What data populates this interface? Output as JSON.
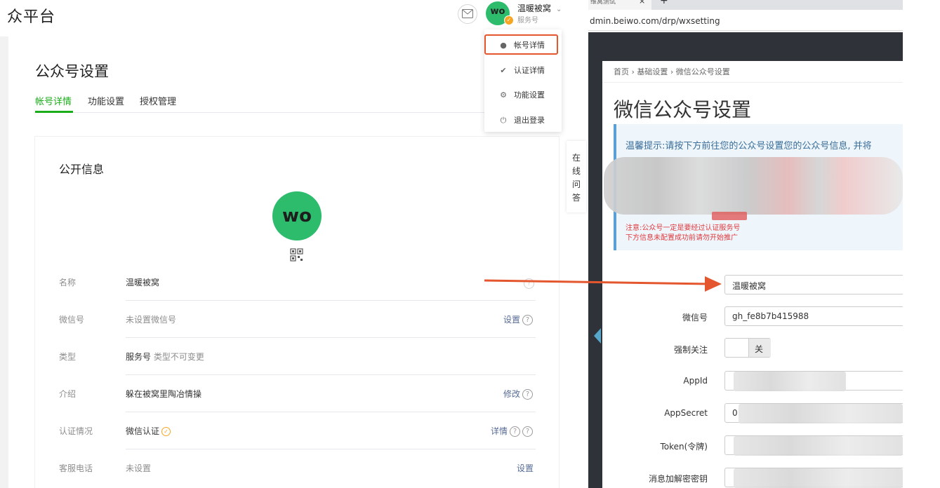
{
  "left": {
    "brand": "众平台",
    "header": {
      "account_name": "温暖被窝",
      "account_type": "服务号",
      "avatar_text": "wo"
    },
    "page_title": "公众号设置",
    "tabs": [
      "帐号详情",
      "功能设置",
      "授权管理"
    ],
    "section_title": "公开信息",
    "qr_icon": "qrcode-icon",
    "rows": [
      {
        "label": "名称",
        "value": "温暖被窝",
        "sub": "",
        "action": ""
      },
      {
        "label": "微信号",
        "value": "未设置微信号",
        "sub": "",
        "action": "设置"
      },
      {
        "label": "类型",
        "value": "服务号",
        "sub": "类型不可变更",
        "action": ""
      },
      {
        "label": "介绍",
        "value": "躲在被窝里陶冶情操",
        "sub": "",
        "action": "修改"
      },
      {
        "label": "认证情况",
        "value": "微信认证",
        "sub": "",
        "action": "详情"
      },
      {
        "label": "客服电话",
        "value": "未设置",
        "sub": "",
        "action": "设置"
      }
    ],
    "help_symbol": "?",
    "dropdown": [
      "帐号详情",
      "认证详情",
      "功能设置",
      "退出登录"
    ],
    "online_qa": [
      "在",
      "线",
      "问",
      "答"
    ]
  },
  "right": {
    "browser_tab_title": "维窝测试",
    "tab_close": "×",
    "tab_new": "+",
    "url": "dmin.beiwo.com/drp/wxsetting",
    "breadcrumb": "首页 › 基础设置 › 微信公众号设置",
    "title": "微信公众号设置",
    "tip": "温馨提示:请按下方前往您的公众号设置您的公众号信息, 并将",
    "note1": "注意:公众号一定是要经过认证服务号",
    "note2": "下方信息未配置成功前请勿开始推广",
    "fields": {
      "name_value": "温暖被窝",
      "wechat_id_label": "微信号",
      "wechat_id_value": "gh_fe8b7b415988",
      "force_follow_label": "强制关注",
      "force_follow_value": "关",
      "appid_label": "AppId",
      "appsecret_label": "AppSecret",
      "appsecret_prefix": "0",
      "token_label": "Token(令牌)",
      "aeskey_label": "消息加解密密钥"
    }
  },
  "colors": {
    "wechat_green": "#1aad19",
    "avatar_green": "#2cbc6c",
    "arrow_orange": "#e4572e",
    "admin_dark": "#2f3238",
    "link_blue": "#576b95"
  }
}
